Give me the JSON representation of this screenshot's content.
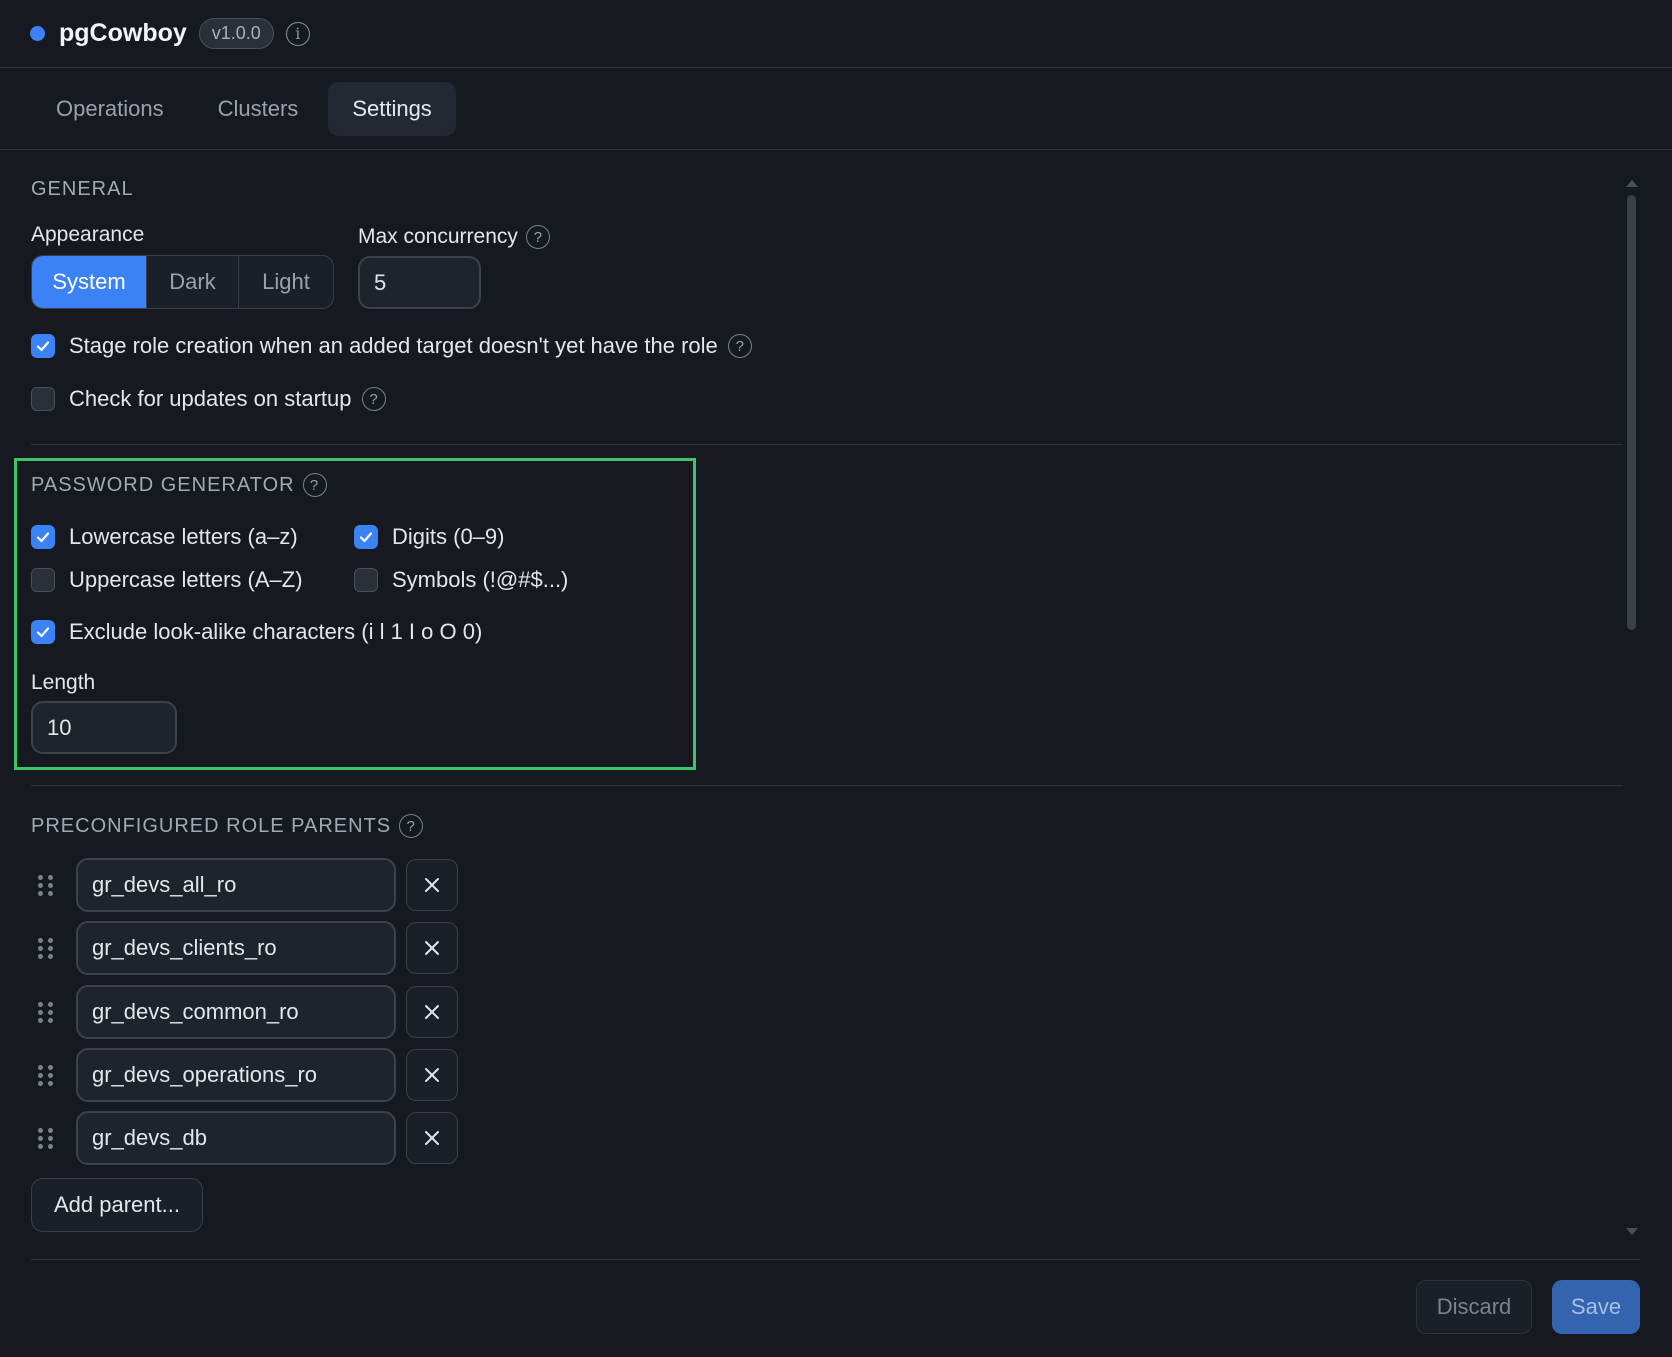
{
  "header": {
    "app_title": "pgCowboy",
    "version": "v1.0.0",
    "info_icon": "i",
    "status_dot_color": "#3b82f6"
  },
  "tabs": [
    {
      "label": "Operations",
      "active": false
    },
    {
      "label": "Clusters",
      "active": false
    },
    {
      "label": "Settings",
      "active": true
    }
  ],
  "general": {
    "title": "GENERAL",
    "appearance_label": "Appearance",
    "appearance_options": [
      "System",
      "Dark",
      "Light"
    ],
    "appearance_selected": "System",
    "max_concurrency_label": "Max concurrency",
    "max_concurrency_value": "5",
    "stage_role_label": "Stage role creation when an added target doesn't yet have the role",
    "stage_role_checked": true,
    "check_updates_label": "Check for updates on startup",
    "check_updates_checked": false
  },
  "password_generator": {
    "title": "PASSWORD GENERATOR",
    "lowercase_label": "Lowercase letters (a–z)",
    "lowercase_checked": true,
    "digits_label": "Digits (0–9)",
    "digits_checked": true,
    "uppercase_label": "Uppercase letters (A–Z)",
    "uppercase_checked": false,
    "symbols_label": "Symbols (!@#$...)",
    "symbols_checked": false,
    "exclude_label": "Exclude look-alike characters (i l 1 I o O 0)",
    "exclude_checked": true,
    "length_label": "Length",
    "length_value": "10",
    "highlight_color": "#3ec46b"
  },
  "role_parents": {
    "title": "PRECONFIGURED ROLE PARENTS",
    "items": [
      "gr_devs_all_ro",
      "gr_devs_clients_ro",
      "gr_devs_common_ro",
      "gr_devs_operations_ro",
      "gr_devs_db"
    ],
    "remove_icon": "close-icon",
    "drag_icon": "drag-handle-icon",
    "add_label": "Add parent..."
  },
  "footer": {
    "discard_label": "Discard",
    "save_label": "Save"
  },
  "colors": {
    "accent": "#3b82f6",
    "background": "#161920"
  }
}
